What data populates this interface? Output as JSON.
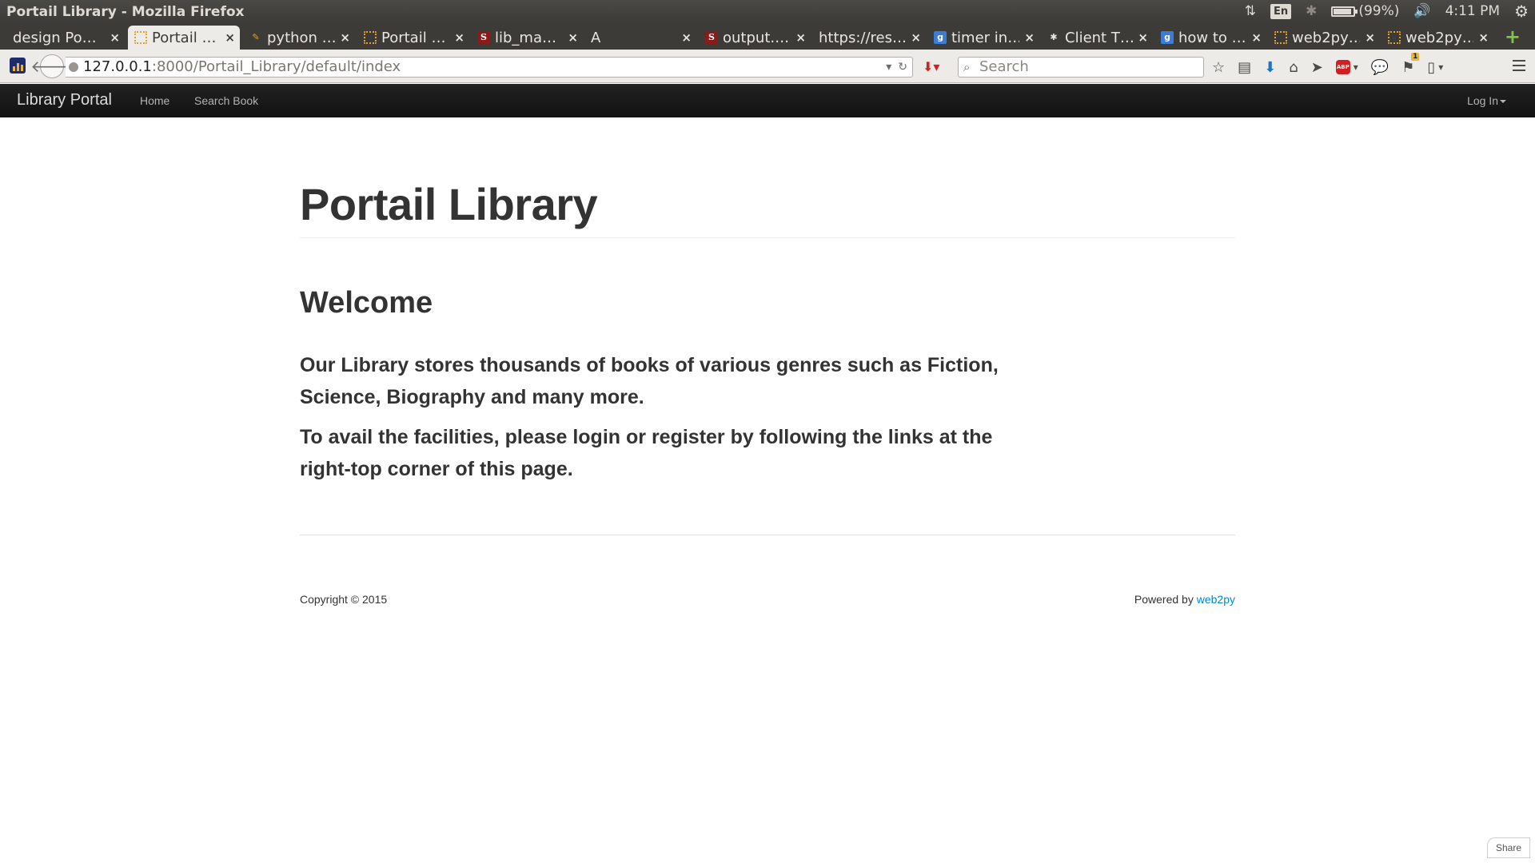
{
  "window": {
    "title": "Portail Library - Mozilla Firefox"
  },
  "tray": {
    "lang": "En",
    "battery": "(99%)",
    "battery_level": 0.99,
    "time": "4:11 PM"
  },
  "tabs": [
    {
      "label": "design Po…",
      "icon": "none",
      "active": false
    },
    {
      "label": "Portail …",
      "icon": "web2py-icon",
      "active": true
    },
    {
      "label": "python …",
      "icon": "python-icon",
      "active": false
    },
    {
      "label": "Portail …",
      "icon": "web2py-icon",
      "active": false
    },
    {
      "label": "lib_ma…",
      "icon": "s-icon",
      "active": false
    },
    {
      "label": "A",
      "icon": "none",
      "active": false
    },
    {
      "label": "output.…",
      "icon": "s-icon",
      "active": false
    },
    {
      "label": "https://res…",
      "icon": "none",
      "active": false
    },
    {
      "label": "timer in…",
      "icon": "google-icon",
      "active": false
    },
    {
      "label": "Client T…",
      "icon": "client-icon",
      "active": false
    },
    {
      "label": "how to …",
      "icon": "google-icon",
      "active": false
    },
    {
      "label": "web2py…",
      "icon": "web2py-icon",
      "active": false
    },
    {
      "label": "web2py…",
      "icon": "web2py-icon",
      "active": false
    }
  ],
  "url": {
    "host": "127.0.0.1",
    "path": ":8000/Portail_Library/default/index"
  },
  "search": {
    "placeholder": "Search"
  },
  "site": {
    "brand": "Library Portal",
    "nav": [
      "Home",
      "Search Book"
    ],
    "login": "Log In"
  },
  "page": {
    "title": "Portail Library",
    "heading": "Welcome",
    "para1": "Our Library stores thousands of books of various genres such as Fiction, Science, Biography and many more.",
    "para2": "To avail the facilities, please login or register by following the links at the right-top corner of this page.",
    "copyright": "Copyright © 2015",
    "powered_by": "Powered by ",
    "powered_link": "web2py"
  },
  "share": "Share",
  "colors": {
    "link": "#0088cc",
    "navbar": "#1b1b1b",
    "text": "#333333"
  }
}
